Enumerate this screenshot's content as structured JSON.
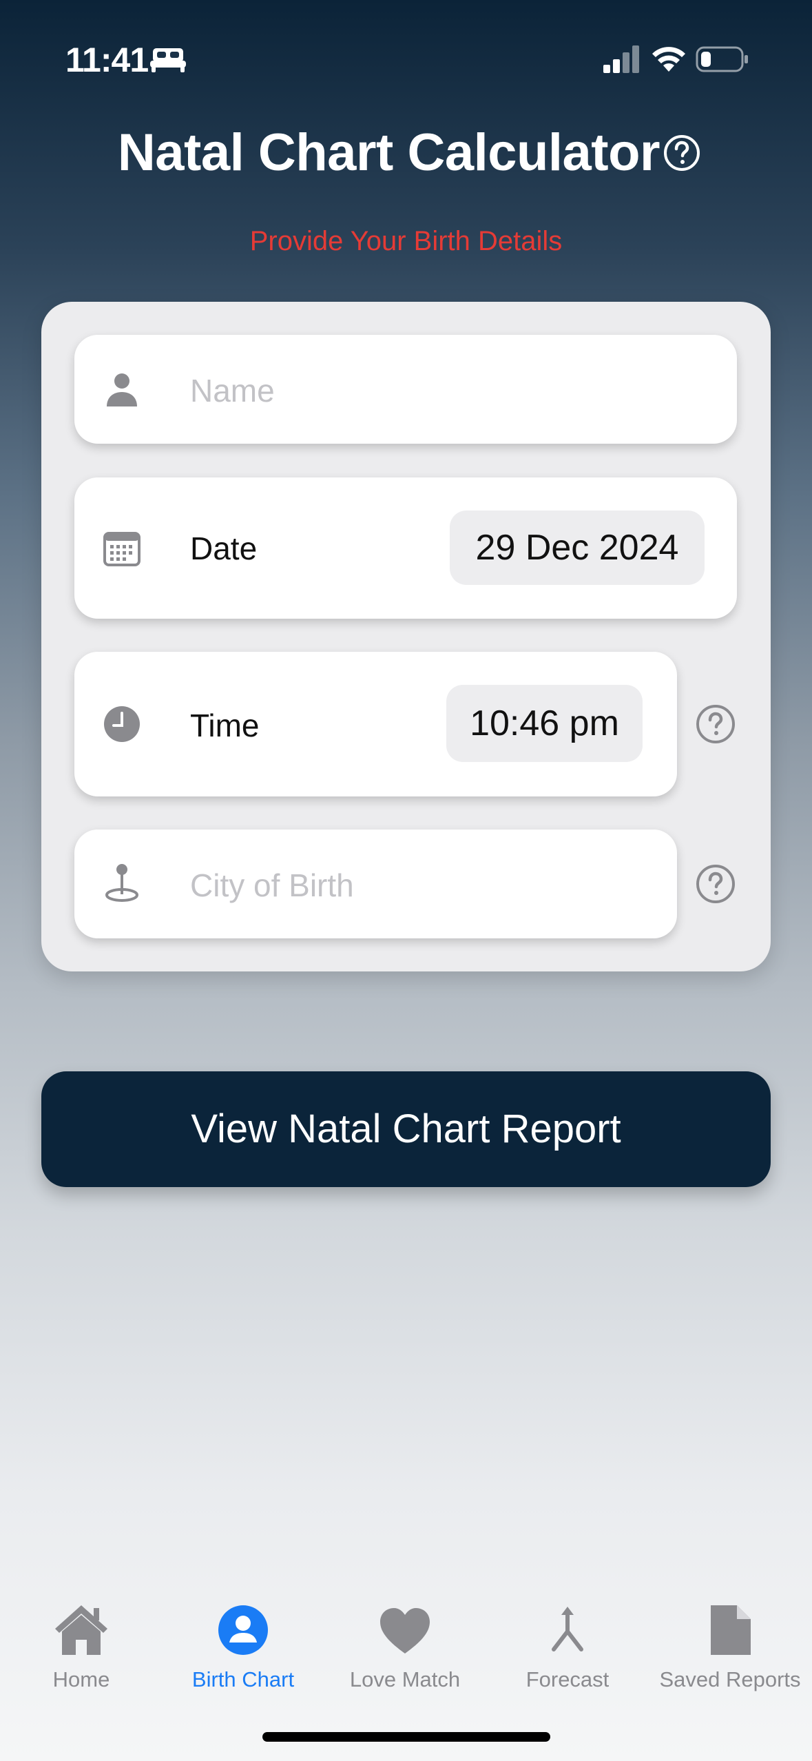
{
  "status_bar": {
    "time": "11:41",
    "icons": [
      "bed-icon",
      "cellular-signal-icon",
      "wifi-icon",
      "battery-icon"
    ]
  },
  "header": {
    "title": "Natal Chart Calculator",
    "subtitle": "Provide Your Birth Details",
    "help_icon": "question-circle-icon"
  },
  "form": {
    "name": {
      "placeholder": "Name",
      "value": "",
      "icon": "person-icon"
    },
    "date": {
      "label": "Date",
      "value": "29 Dec 2024",
      "icon": "calendar-icon"
    },
    "time": {
      "label": "Time",
      "value": "10:46 pm",
      "icon": "clock-icon"
    },
    "city": {
      "placeholder": "City of Birth",
      "value": "",
      "icon": "location-pin-icon"
    }
  },
  "primary_button": {
    "label": "View Natal Chart Report"
  },
  "tab_bar": {
    "items": [
      {
        "label": "Home",
        "icon": "house-icon",
        "active": false
      },
      {
        "label": "Birth Chart",
        "icon": "person-circle-icon",
        "active": true
      },
      {
        "label": "Love Match",
        "icon": "heart-icon",
        "active": false
      },
      {
        "label": "Forecast",
        "icon": "merge-arrow-icon",
        "active": false
      },
      {
        "label": "Saved Reports",
        "icon": "document-icon",
        "active": false
      }
    ]
  },
  "colors": {
    "accent": "#1a7cf5",
    "subtitle_red": "#e53b36",
    "button_navy": "#0b243a",
    "icon_gray": "#8a8a8e"
  }
}
